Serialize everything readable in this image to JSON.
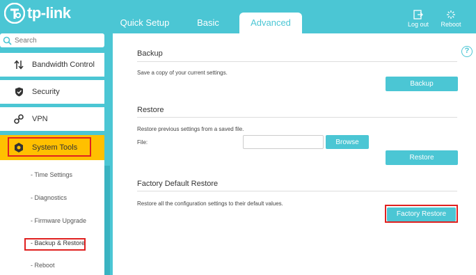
{
  "brand": {
    "name": "tp-link"
  },
  "nav": {
    "tabs": [
      {
        "label": "Quick Setup"
      },
      {
        "label": "Basic"
      },
      {
        "label": "Advanced"
      }
    ],
    "logout_label": "Log out",
    "reboot_label": "Reboot"
  },
  "sidebar": {
    "search_placeholder": "Search",
    "items": [
      {
        "label": "Bandwidth Control",
        "icon": "arrows-updown-icon"
      },
      {
        "label": "Security",
        "icon": "shield-icon"
      },
      {
        "label": "VPN",
        "icon": "vpn-icon"
      },
      {
        "label": "System Tools",
        "icon": "gear-icon"
      }
    ],
    "subitems": [
      {
        "label": "- Time Settings"
      },
      {
        "label": "- Diagnostics"
      },
      {
        "label": "- Firmware Upgrade"
      },
      {
        "label": "- Backup & Restore"
      },
      {
        "label": "- Reboot"
      }
    ]
  },
  "backup": {
    "title": "Backup",
    "description": "Save a copy of your current settings.",
    "button_label": "Backup"
  },
  "restore": {
    "title": "Restore",
    "description": "Restore previous settings from a saved file.",
    "file_label": "File:",
    "file_value": "",
    "browse_label": "Browse",
    "button_label": "Restore"
  },
  "factory": {
    "title": "Factory Default Restore",
    "description": "Restore all the configuration settings to their default values.",
    "button_label": "Factory Restore"
  },
  "colors": {
    "accent": "#4bc6d4",
    "active_menu": "#ffc000",
    "highlight_border": "#e0201f"
  }
}
